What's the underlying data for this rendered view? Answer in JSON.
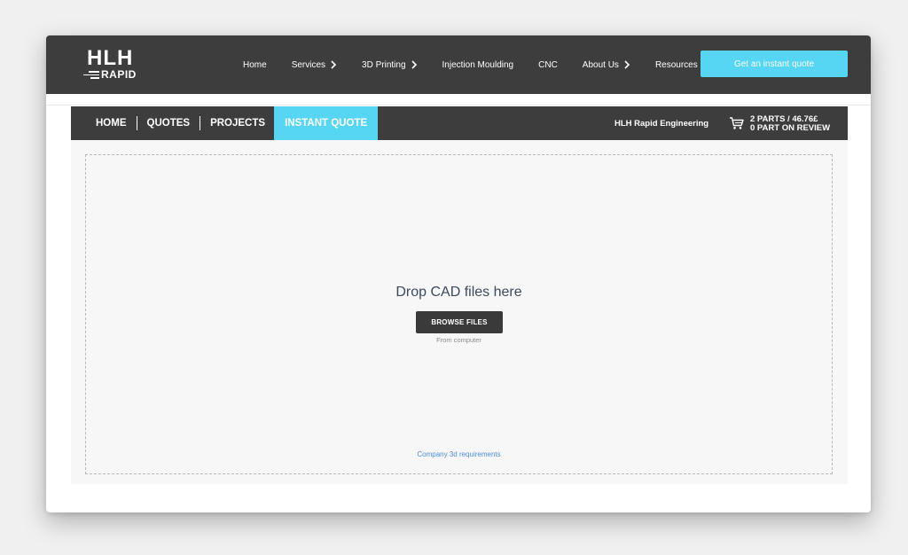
{
  "logo": {
    "line1": "HLH",
    "line2": "RAPID"
  },
  "nav": {
    "items": [
      {
        "label": "Home",
        "has_chevron": false
      },
      {
        "label": "Services",
        "has_chevron": true
      },
      {
        "label": "3D Printing",
        "has_chevron": true
      },
      {
        "label": "Injection Moulding",
        "has_chevron": false
      },
      {
        "label": "CNC",
        "has_chevron": false
      },
      {
        "label": "About Us",
        "has_chevron": true
      },
      {
        "label": "Resources",
        "has_chevron": true
      }
    ],
    "cta_label": "Get an instant quote"
  },
  "subnav": {
    "items": [
      "HOME",
      "QUOTES",
      "PROJECTS"
    ],
    "active": "INSTANT QUOTE",
    "company": "HLH Rapid Engineering",
    "cart_line1": "2 PARTS / 46.76£",
    "cart_line2": "0 PART ON REVIEW"
  },
  "dropzone": {
    "title": "Drop CAD files here",
    "browse_label": "BROWSE FILES",
    "from_label": "From computer",
    "requirements_link": "Company 3d requirements"
  },
  "colors": {
    "header_bg": "#3d3d3d",
    "accent": "#56d6f2",
    "link": "#4a90d9",
    "page_bg": "#f7f7f7"
  }
}
